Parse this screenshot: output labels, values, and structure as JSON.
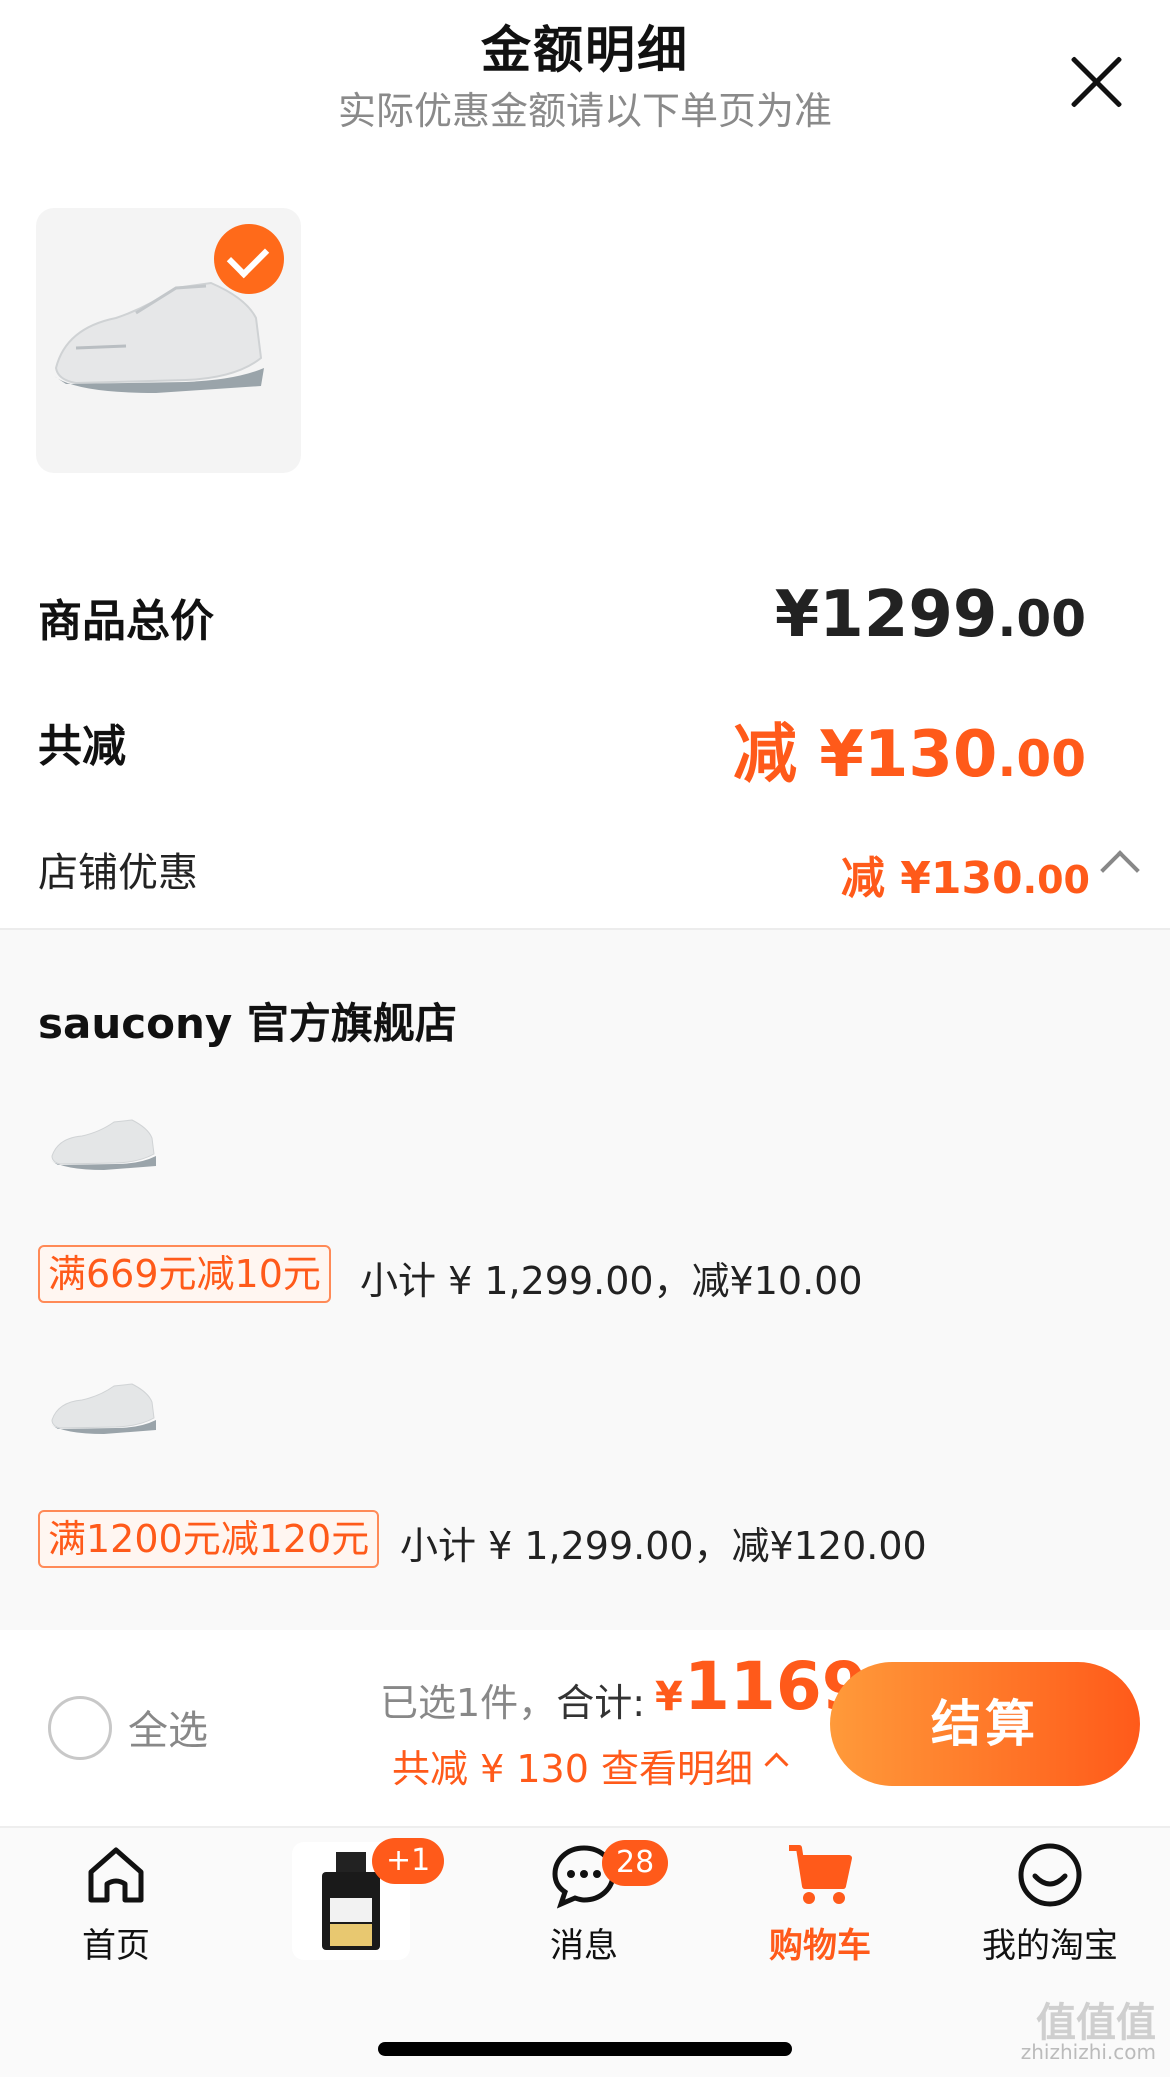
{
  "header": {
    "title": "金额明细",
    "subtitle": "实际优惠金额请以下单页为准"
  },
  "summary": {
    "total_label": "商品总价",
    "total_int": "¥1299",
    "total_dec": ".00",
    "discount_label": "共减",
    "discount_int": "减 ¥130",
    "discount_dec": ".00",
    "store_discount_label": "店铺优惠",
    "store_discount_int": "减 ¥130",
    "store_discount_dec": ".00"
  },
  "store": {
    "name": "saucony 官方旗舰店",
    "promos": [
      {
        "tag": "满669元减10元",
        "subtotal": "小计 ¥ 1,299.00，减¥10.00"
      },
      {
        "tag": "满1200元减120元",
        "subtotal": "小计 ¥ 1,299.00，减¥120.00"
      }
    ]
  },
  "bottom_bar": {
    "select_all": "全选",
    "selected_text": "已选1件，",
    "total_label": "合计:",
    "total_symbol": "¥",
    "total_value": "1169",
    "saved_text": "共减 ¥ 130  查看明细",
    "checkout": "结算"
  },
  "tabs": [
    {
      "label": "首页",
      "icon": "home-icon"
    },
    {
      "label": "",
      "icon": "product-thumbnail",
      "badge": "+1"
    },
    {
      "label": "消息",
      "icon": "message-icon",
      "badge": "28"
    },
    {
      "label": "购物车",
      "icon": "cart-icon",
      "active": true
    },
    {
      "label": "我的淘宝",
      "icon": "smile-icon"
    }
  ],
  "watermark": {
    "main": "值值值",
    "sub": "zhizhizhi.com"
  },
  "colors": {
    "accent": "#ff5a1a",
    "accent_light": "#ff9a3a"
  }
}
